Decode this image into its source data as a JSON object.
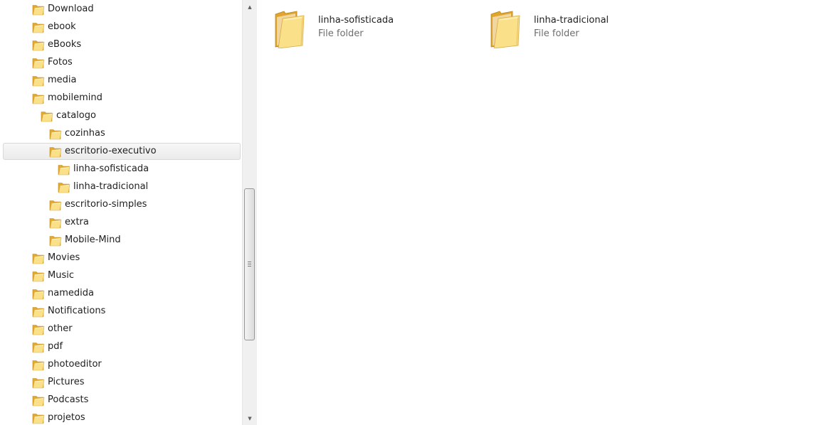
{
  "nav": {
    "items": [
      {
        "label": "Download",
        "level": 0,
        "selected": false
      },
      {
        "label": "ebook",
        "level": 0,
        "selected": false
      },
      {
        "label": "eBooks",
        "level": 0,
        "selected": false
      },
      {
        "label": "Fotos",
        "level": 0,
        "selected": false
      },
      {
        "label": "media",
        "level": 0,
        "selected": false
      },
      {
        "label": "mobilemind",
        "level": 0,
        "selected": false
      },
      {
        "label": "catalogo",
        "level": 1,
        "selected": false
      },
      {
        "label": "cozinhas",
        "level": 2,
        "selected": false
      },
      {
        "label": "escritorio-executivo",
        "level": 2,
        "selected": true
      },
      {
        "label": "linha-sofisticada",
        "level": 3,
        "selected": false
      },
      {
        "label": "linha-tradicional",
        "level": 3,
        "selected": false
      },
      {
        "label": "escritorio-simples",
        "level": 2,
        "selected": false
      },
      {
        "label": "extra",
        "level": 2,
        "selected": false
      },
      {
        "label": "Mobile-Mind",
        "level": 2,
        "selected": false
      },
      {
        "label": "Movies",
        "level": 0,
        "selected": false
      },
      {
        "label": "Music",
        "level": 0,
        "selected": false
      },
      {
        "label": "namedida",
        "level": 0,
        "selected": false
      },
      {
        "label": "Notifications",
        "level": 0,
        "selected": false
      },
      {
        "label": "other",
        "level": 0,
        "selected": false
      },
      {
        "label": "pdf",
        "level": 0,
        "selected": false
      },
      {
        "label": "photoeditor",
        "level": 0,
        "selected": false
      },
      {
        "label": "Pictures",
        "level": 0,
        "selected": false
      },
      {
        "label": "Podcasts",
        "level": 0,
        "selected": false
      },
      {
        "label": "projetos",
        "level": 0,
        "selected": false
      }
    ],
    "item_icon": "folder-icon"
  },
  "scrollbar": {
    "up_icon": "scroll-up-arrow-icon",
    "down_icon": "scroll-down-arrow-icon",
    "grip_icon": "scroll-grip-icon"
  },
  "content": {
    "items": [
      {
        "name": "linha-sofisticada",
        "type": "File folder",
        "icon": "folder-icon"
      },
      {
        "name": "linha-tradicional",
        "type": "File folder",
        "icon": "folder-icon"
      }
    ]
  },
  "colors": {
    "folder_back": "#e8b23a",
    "folder_front": "#fbe28a",
    "selection_border": "#d9d9d9",
    "text_primary": "#1e1e1e",
    "text_secondary": "#6d6d6d"
  }
}
